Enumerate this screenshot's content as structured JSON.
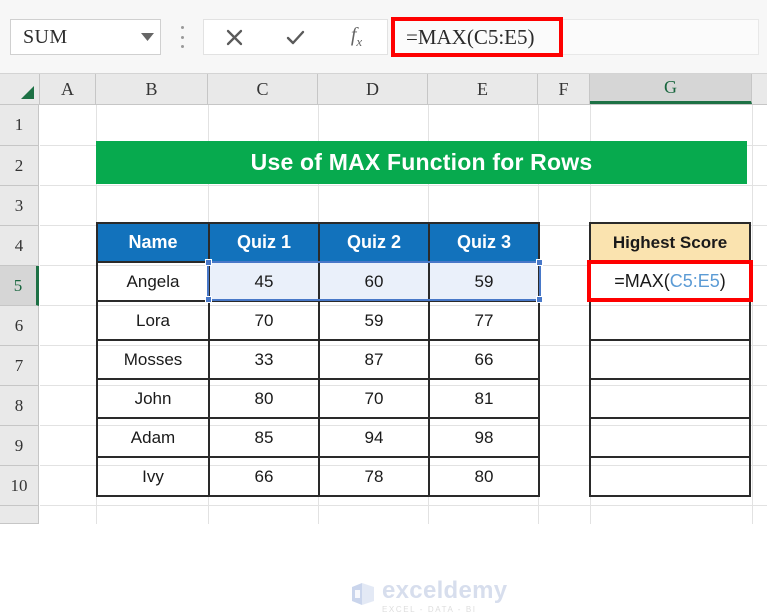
{
  "app": {
    "name_box_value": "SUM",
    "formula_bar_value": "=MAX(C5:E5)",
    "icons": {
      "dropdown": "chevron-down-icon",
      "cancel": "cancel-x-icon",
      "enter": "check-icon",
      "insert_function": "fx-icon"
    }
  },
  "columns": [
    "A",
    "B",
    "C",
    "D",
    "E",
    "F",
    "G"
  ],
  "active_column": "G",
  "rows": [
    "1",
    "2",
    "3",
    "4",
    "5",
    "6",
    "7",
    "8",
    "9",
    "10"
  ],
  "active_row": "5",
  "banner": {
    "title": "Use of MAX Function for Rows",
    "bg_color": "#07AA4E",
    "text_color": "#FFFFFF"
  },
  "main_table": {
    "header_bg": "#1272BC",
    "headers": [
      "Name",
      "Quiz 1",
      "Quiz 2",
      "Quiz 3"
    ],
    "rows": [
      {
        "name": "Angela",
        "quiz1": "45",
        "quiz2": "60",
        "quiz3": "59"
      },
      {
        "name": "Lora",
        "quiz1": "70",
        "quiz2": "59",
        "quiz3": "77"
      },
      {
        "name": "Mosses",
        "quiz1": "33",
        "quiz2": "87",
        "quiz3": "66"
      },
      {
        "name": "John",
        "quiz1": "80",
        "quiz2": "70",
        "quiz3": "81"
      },
      {
        "name": "Adam",
        "quiz1": "85",
        "quiz2": "94",
        "quiz3": "98"
      },
      {
        "name": "Ivy",
        "quiz1": "66",
        "quiz2": "78",
        "quiz3": "80"
      }
    ],
    "selected_range": "C5:E5"
  },
  "score_table": {
    "header": "Highest Score",
    "header_bg": "#FAE3AF",
    "formula_prefix": "=MAX(",
    "formula_ref": "C5:E5",
    "formula_suffix": ")",
    "ref_color": "#5B9BD5",
    "highlight_color": "#FE0000",
    "empty_cells": [
      "",
      "",
      "",
      "",
      ""
    ]
  },
  "watermark": {
    "name": "exceldemy",
    "tagline": "EXCEL - DATA - BI"
  }
}
